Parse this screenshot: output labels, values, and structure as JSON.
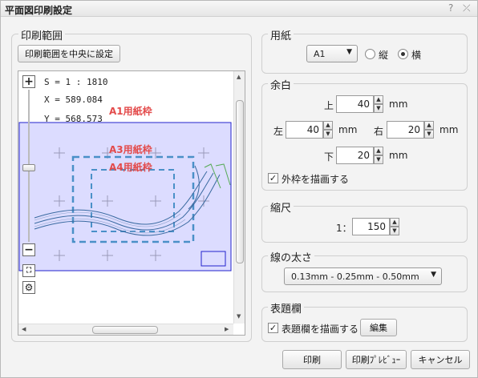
{
  "title": "平面図印刷設定",
  "titlebar": {
    "help_icon": "?",
    "close_icon": "⤫"
  },
  "print_range": {
    "label": "印刷範囲",
    "center_button": "印刷範囲を中央に設定",
    "scale_readout": "S = 1 : 1810",
    "x_readout": "X = 589.084",
    "y_readout": "Y = 568.573",
    "frame_labels": [
      "A1用紙枠",
      "A3用紙枠",
      "A4用紙枠"
    ]
  },
  "paper": {
    "label": "用紙",
    "size_value": "A1",
    "orientation_options": [
      "縦",
      "横"
    ],
    "selected_orientation": "横"
  },
  "margin": {
    "label": "余白",
    "top_label": "上",
    "top_value": "40",
    "left_label": "左",
    "left_value": "40",
    "right_label": "右",
    "right_value": "20",
    "bottom_label": "下",
    "bottom_value": "20",
    "unit": "mm",
    "draw_border_label": "外枠を描画する",
    "draw_border_checked": true
  },
  "scale": {
    "label": "縮尺",
    "prefix": "1：",
    "value": "150"
  },
  "line_width": {
    "label": "線の太さ",
    "value": "0.13mm - 0.25mm - 0.50mm"
  },
  "title_block": {
    "label": "表題欄",
    "draw_label": "表題欄を描画する",
    "draw_checked": true,
    "edit_button": "編集"
  },
  "footer": {
    "print_button": "印刷",
    "preview_button": "印刷ﾌﾟﾚﾋﾞｭｰ",
    "cancel_button": "キャンセル"
  },
  "colors": {
    "a1_frame": "#2222cc",
    "a1_fill": "#dcdcff",
    "a3_frame": "#4a90c8",
    "red_label": "#e34b4b"
  }
}
